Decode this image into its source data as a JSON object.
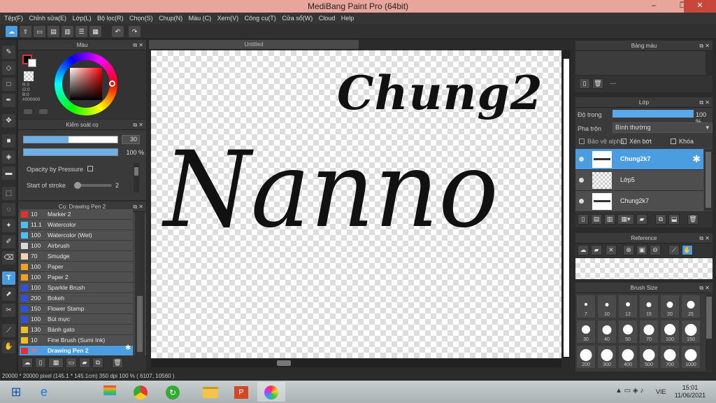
{
  "app": {
    "title": "MediBang Paint Pro (64bit)",
    "minimize": "–",
    "restore": "❐",
    "close": "✕"
  },
  "menu": [
    "Tệp(F)",
    "Chỉnh sửa(E)",
    "Lớp(L)",
    "Bộ lọc(R)",
    "Chọn(S)",
    "Chụp(N)",
    "Màu (C)",
    "Xem(V)",
    "Công cụ(T)",
    "Cửa sổ(W)",
    "Cloud",
    "Help"
  ],
  "color_panel": {
    "title": "Màu",
    "rgb": [
      "R:0",
      "G:0",
      "B:0"
    ],
    "hex": "#000000"
  },
  "brush_control": {
    "title": "Kiểm soát cọ",
    "size_value": "30",
    "opacity_value": "100",
    "opacity_unit": "%",
    "size_fill": 0.48,
    "opacity_fill": 1.0,
    "opacity_by_pressure": "Opacity by Pressure",
    "start_of_stroke": "Start of stroke",
    "start_value": "2"
  },
  "brush_panel": {
    "title": "Cọ: Drawing Pen 2",
    "items": [
      {
        "size": "10",
        "name": "Marker 2",
        "color": "#e03030"
      },
      {
        "size": "11.1",
        "name": "Watercolor",
        "color": "#4ac0f0"
      },
      {
        "size": "100",
        "name": "Watercolor (Wet)",
        "color": "#4ac0f0"
      },
      {
        "size": "100",
        "name": "Airbrush",
        "color": "#d8d8d8"
      },
      {
        "size": "70",
        "name": "Smudge",
        "color": "#f4d0b8"
      },
      {
        "size": "100",
        "name": "Paper",
        "color": "#f0a020"
      },
      {
        "size": "100",
        "name": "Paper 2",
        "color": "#f0a020"
      },
      {
        "size": "100",
        "name": "Sparkle Brush",
        "color": "#3050e0"
      },
      {
        "size": "200",
        "name": "Bokeh",
        "color": "#3050e0"
      },
      {
        "size": "150",
        "name": "Flower Stamp",
        "color": "#3050e0"
      },
      {
        "size": "100",
        "name": "Bút mực",
        "color": "#3050e0"
      },
      {
        "size": "130",
        "name": "Bánh gato",
        "color": "#f0c020"
      },
      {
        "size": "10",
        "name": "Fine Brush (Sumi Ink)",
        "color": "#f0c020"
      },
      {
        "size": "30",
        "name": "Drawing Pen 2",
        "color": "#e03030"
      }
    ]
  },
  "canvas": {
    "tab": "Untitled",
    "text_top": "Chung2",
    "text_main": "Nanno"
  },
  "palette_panel": {
    "title": "Bảng màu",
    "dash": "---"
  },
  "layer_panel": {
    "title": "Lớp",
    "opacity_label": "Độ trong",
    "opacity_value": "100 %",
    "opacity_fill": 1.0,
    "blend_label": "Pha trộn",
    "blend_value": "Bình thường",
    "protect_alpha": "Bảo vệ alpha",
    "clipping": "Xén bớt",
    "lock": "Khóa",
    "layers": [
      "Chung2k7",
      "Lớp5",
      "Chung2k7"
    ]
  },
  "reference_panel": {
    "title": "Reference"
  },
  "brush_size_panel": {
    "title": "Brush Size",
    "sizes": [
      "7",
      "10",
      "12",
      "15",
      "20",
      "25",
      "30",
      "40",
      "50",
      "70",
      "100",
      "150",
      "200",
      "300",
      "400",
      "500",
      "700",
      "1000"
    ]
  },
  "status": {
    "text": "20000 * 20000 pixel  (145.1 * 145.1cm)  350 dpi  100 %  ( 6107, 10560 )"
  },
  "taskbar": {
    "lang": "VIE",
    "time": "15:01",
    "date": "11/06/2021"
  }
}
